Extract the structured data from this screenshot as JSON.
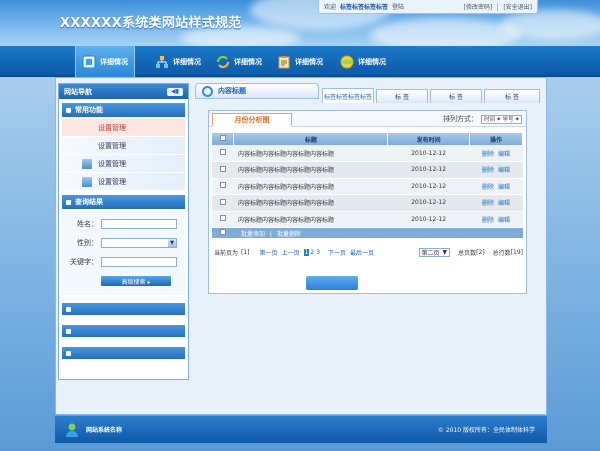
{
  "header": {
    "site_title": "XXXXXX系统类网站样式规范",
    "welcome": "欢迎",
    "username": "标签标签标签标签",
    "logout": "登陆",
    "change_password": "[修改密码]",
    "safe_exit": "[安全退出]"
  },
  "nav": {
    "items": [
      {
        "label": "详细情况",
        "icon": "document-icon"
      },
      {
        "label": "详细情况",
        "icon": "network-icon"
      },
      {
        "label": "详细情况",
        "icon": "refresh-icon"
      },
      {
        "label": "详细情况",
        "icon": "clipboard-icon"
      },
      {
        "label": "详细情况",
        "icon": "globe-icon"
      }
    ]
  },
  "sidebar": {
    "title": "网站导航",
    "back": "◀▮",
    "common_title": "常用功能",
    "menu": [
      {
        "label": "设置管理"
      },
      {
        "label": "设置管理"
      },
      {
        "label": "设置管理"
      },
      {
        "label": "设置管理"
      }
    ],
    "search_title": "查询结果",
    "name_label": "姓名：",
    "gender_label": "性别：",
    "keyword_label": "关键字：",
    "gender_arrow": "▼",
    "search_button": "高级搜索 ▸"
  },
  "content": {
    "title": "内容标题",
    "tabs": [
      "标签标签标签标签",
      "标 签",
      "标 签",
      "标 签"
    ],
    "analysis_tab": "月份分析图",
    "sort_label": "排列方式：",
    "sort_a": "时间",
    "sort_b": "学号",
    "sort_arrow": "◆",
    "columns": [
      "标题",
      "发布时间",
      "操作"
    ],
    "rows": [
      {
        "title": "内容标题内容标题内容标题内容标题",
        "date": "2010-12-12",
        "delete": "删除",
        "edit": "编辑"
      },
      {
        "title": "内容标题内容标题内容标题内容标题",
        "date": "2010-12-12",
        "delete": "删除",
        "edit": "编辑"
      },
      {
        "title": "内容标题内容标题内容标题内容标题",
        "date": "2010-12-12",
        "delete": "删除",
        "edit": "编辑"
      },
      {
        "title": "内容标题内容标题内容标题内容标题",
        "date": "2010-12-12",
        "delete": "删除",
        "edit": "编辑"
      },
      {
        "title": "内容标题内容标题内容标题内容标题",
        "date": "2010-12-12",
        "delete": "删除",
        "edit": "编辑"
      }
    ],
    "batch_add": "批量添加",
    "batch_sep": "|",
    "batch_delete": "批量删除"
  },
  "pager": {
    "current_label": "当前页为",
    "current_value": "[1]",
    "first": "第一页",
    "prev": "上一页",
    "page1": "1",
    "page2": "2",
    "page3": "3",
    "next": "下一页",
    "last": "最后一页",
    "page_select": "第二页",
    "page_select_arrow": "▼",
    "total_pages_label": "总页数",
    "total_pages_value": "[2]",
    "total_rows_label": "总行数",
    "total_rows_value": "[19]"
  },
  "footer": {
    "system_name": "网站系统名称",
    "copyright": "© 2010 版权所有：全民体制体科学"
  }
}
